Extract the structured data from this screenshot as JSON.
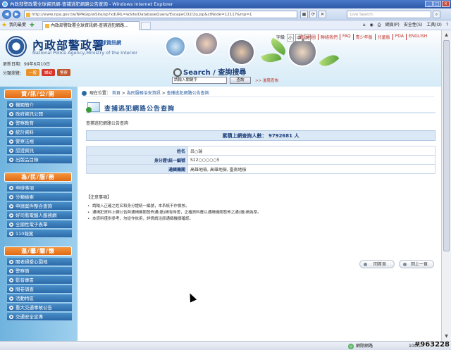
{
  "browser": {
    "title": "內政部警政署全球資訊網-查捕逃犯網路公告查詢 - Windows Internet Explorer",
    "url": "http://www.npa.gov.tw/NPAGip/wSite/sp?xdURL=wSite/DatabaseQuery/EscapeCD2/2q.jsp&ctNode=12117&mp=1",
    "search_placeholder": "Live Search",
    "favorites_label": "我的最愛",
    "tab_title": "內政部警政署全球資訊網-查捕逃犯網路...",
    "commands": [
      "網頁(P)",
      "安全性(S)",
      "工具(O)"
    ],
    "status_zone": "網際網路",
    "zoom": "100%"
  },
  "site": {
    "name": "內政部警政署",
    "name_suffix": "全球資訊網",
    "name_en": "National Police Agency,Ministry of the Interior",
    "update_date": "更新日期：99年6月10日",
    "share_label": "分類瀏覽：",
    "share_pills": [
      {
        "label": "一般",
        "color": "#e8912a"
      },
      {
        "label": "婦幼",
        "color": "#d8342a"
      },
      {
        "label": "警察",
        "color": "#c2542a"
      }
    ],
    "lang_buttons": [
      "字級",
      "小",
      "中",
      "大"
    ],
    "top_links": [
      "網站地圖",
      "聯絡我們",
      "FAQ",
      "青少年版",
      "兒童版",
      "PDA",
      "ENGLISH"
    ],
    "search_title": "Search / 查詢搜尋",
    "search_placeholder": "請輸入關鍵字",
    "search_button": "查詢",
    "advanced_search": ">> 進階查詢"
  },
  "sidebar": {
    "groups": [
      {
        "title": "資/訊/公/開",
        "items": [
          "機關簡介",
          "政府資訊公開",
          "警察教育",
          "統計資料",
          "警察法規",
          "認證資訊",
          "出版品目錄"
        ]
      },
      {
        "title": "為/民/服/務",
        "items": [
          "申辦事項",
          "分類檢索",
          "申請案件整合查詢",
          "好司看電腦人服務網",
          "全國性電子表單",
          "110報案"
        ]
      },
      {
        "title": "溫/馨/關/懷",
        "items": [
          "關老婦愛心園地",
          "警察情",
          "影音專區",
          "問卷調查",
          "活動特區",
          "重大交通事故公告",
          "交通安全宣導"
        ]
      }
    ]
  },
  "main": {
    "breadcrumb_prefix": "現在位置：",
    "breadcrumb": [
      "首頁",
      "為民服務治安資訊",
      "查捕逃犯網路公告查詢"
    ],
    "page_title": "查捕逃犯網路公告查詢",
    "subtitle": "查捕逃犯網路公告查詢",
    "total_count": "累積上網查詢人數： 9792681 人",
    "detail_rows": [
      {
        "label": "姓名",
        "value": "呂○瑞"
      },
      {
        "label": "身分證\\統一編號",
        "value": "S12○○○○○5"
      },
      {
        "label": "通緝機關",
        "value": "高雄地檢, 高雄地檢, 臺南地檢"
      }
    ],
    "notes_title": "【注意事項】",
    "notes": [
      "請輸入正確之姓名和身分證統一編號，本系統不作檢核。",
      "通緝犯資料上網公告與通緝機關發佈通(撤)緝有時差，正確資料應以通緝機關發佈之通(撤)緝為準。",
      "本資料僅供參考，勿從作依用，詳情請洽原通緝機關確認。"
    ],
    "buttons": [
      "回首頁",
      "回上一頁"
    ]
  },
  "watermark": "#963228"
}
